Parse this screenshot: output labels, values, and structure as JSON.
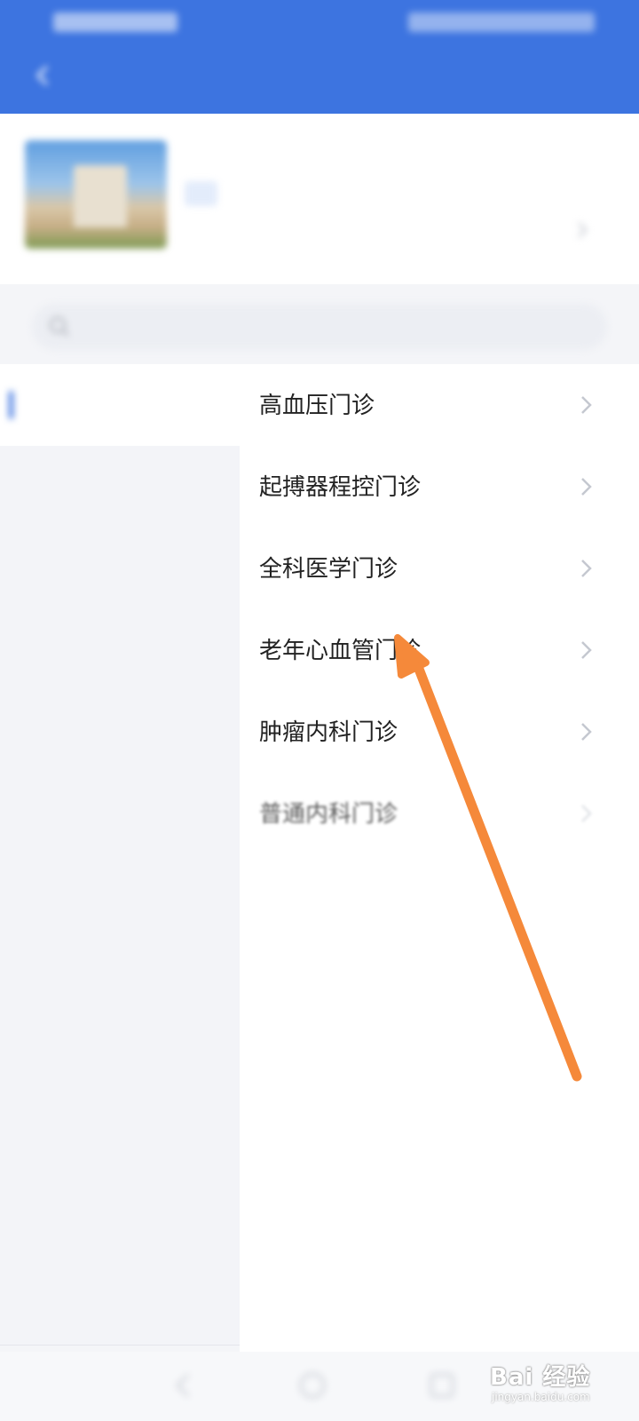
{
  "departments": [
    "高血压门诊",
    "起搏器程控门诊",
    "全科医学门诊",
    "老年心血管门诊",
    "肿瘤内科门诊",
    "普通内科门诊"
  ],
  "colors": {
    "header_bg": "#3d74e0",
    "accent": "#3d74e0",
    "annotation_arrow": "#f5893a"
  },
  "icons": {
    "back": "chevron-left-icon",
    "search": "search-icon",
    "row": "chevron-right-icon"
  },
  "watermark": {
    "brand": "Bai 经验",
    "url": "jingyan.baidu.com"
  }
}
